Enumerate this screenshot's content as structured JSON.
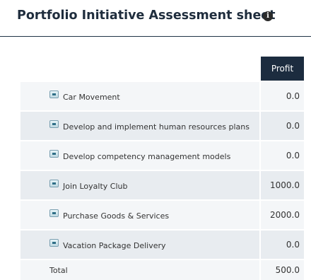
{
  "header": {
    "title": "Portfolio Initiative Assessment sheet",
    "info_icon": "info-icon"
  },
  "table": {
    "columns": [
      "Profit"
    ],
    "rows": [
      {
        "label": "Car Movement",
        "profit": "0.0"
      },
      {
        "label": "Develop and implement human resources plans",
        "profit": "0.0"
      },
      {
        "label": "Develop competency management models",
        "profit": "0.0"
      },
      {
        "label": "Join Loyalty Club",
        "profit": "1000.0"
      },
      {
        "label": "Purchase Goods & Services",
        "profit": "2000.0"
      },
      {
        "label": "Vacation Package Delivery",
        "profit": "0.0"
      }
    ],
    "total": {
      "label": "Total",
      "profit": "500.0"
    }
  },
  "colors": {
    "header_bg": "#1c2c3f",
    "row_light": "#f4f6f8",
    "row_dark": "#e8ecf0"
  }
}
